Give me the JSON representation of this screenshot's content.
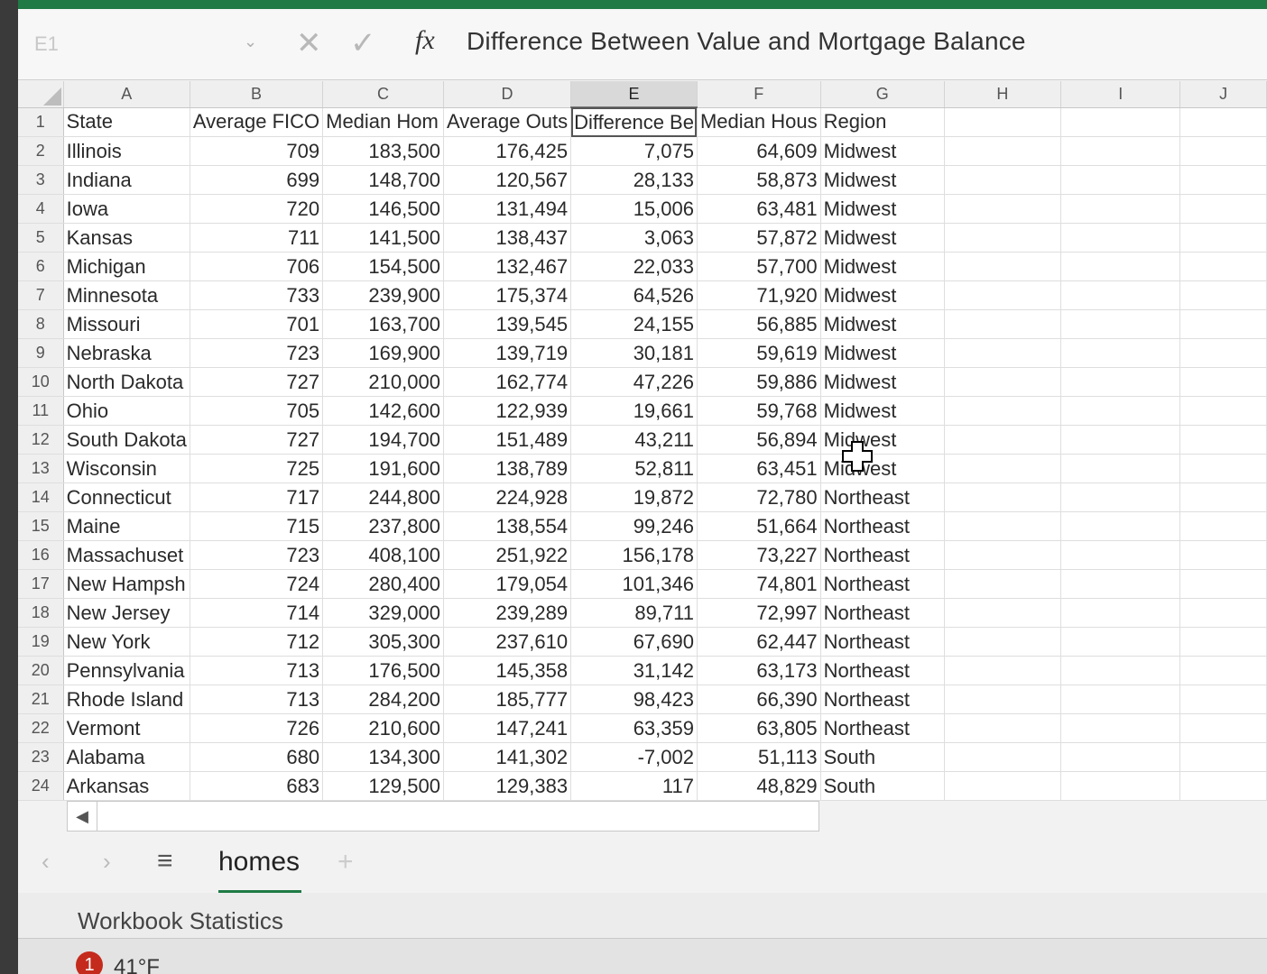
{
  "formula_bar": {
    "name_box": "E1",
    "fx_label": "fx",
    "cancel_glyph": "✕",
    "enter_glyph": "✓",
    "content": "Difference Between Value and Mortgage Balance"
  },
  "columns": [
    "A",
    "B",
    "C",
    "D",
    "E",
    "F",
    "G",
    "H",
    "I",
    "J"
  ],
  "selected_column": "E",
  "rows": [
    {
      "n": "1",
      "cells": [
        "State",
        "Average FICO",
        "Median Hom",
        "Average Outs",
        "Difference Be",
        "Median Hous",
        "Region"
      ]
    },
    {
      "n": "2",
      "cells": [
        "Illinois",
        "709",
        "183,500",
        "176,425",
        "7,075",
        "64,609",
        "Midwest"
      ]
    },
    {
      "n": "3",
      "cells": [
        "Indiana",
        "699",
        "148,700",
        "120,567",
        "28,133",
        "58,873",
        "Midwest"
      ]
    },
    {
      "n": "4",
      "cells": [
        "Iowa",
        "720",
        "146,500",
        "131,494",
        "15,006",
        "63,481",
        "Midwest"
      ]
    },
    {
      "n": "5",
      "cells": [
        "Kansas",
        "711",
        "141,500",
        "138,437",
        "3,063",
        "57,872",
        "Midwest"
      ]
    },
    {
      "n": "6",
      "cells": [
        "Michigan",
        "706",
        "154,500",
        "132,467",
        "22,033",
        "57,700",
        "Midwest"
      ]
    },
    {
      "n": "7",
      "cells": [
        "Minnesota",
        "733",
        "239,900",
        "175,374",
        "64,526",
        "71,920",
        "Midwest"
      ]
    },
    {
      "n": "8",
      "cells": [
        "Missouri",
        "701",
        "163,700",
        "139,545",
        "24,155",
        "56,885",
        "Midwest"
      ]
    },
    {
      "n": "9",
      "cells": [
        "Nebraska",
        "723",
        "169,900",
        "139,719",
        "30,181",
        "59,619",
        "Midwest"
      ]
    },
    {
      "n": "10",
      "cells": [
        "North Dakota",
        "727",
        "210,000",
        "162,774",
        "47,226",
        "59,886",
        "Midwest"
      ]
    },
    {
      "n": "11",
      "cells": [
        "Ohio",
        "705",
        "142,600",
        "122,939",
        "19,661",
        "59,768",
        "Midwest"
      ]
    },
    {
      "n": "12",
      "cells": [
        "South Dakota",
        "727",
        "194,700",
        "151,489",
        "43,211",
        "56,894",
        "Midwest"
      ]
    },
    {
      "n": "13",
      "cells": [
        "Wisconsin",
        "725",
        "191,600",
        "138,789",
        "52,811",
        "63,451",
        "Midwest"
      ]
    },
    {
      "n": "14",
      "cells": [
        "Connecticut",
        "717",
        "244,800",
        "224,928",
        "19,872",
        "72,780",
        "Northeast"
      ]
    },
    {
      "n": "15",
      "cells": [
        "Maine",
        "715",
        "237,800",
        "138,554",
        "99,246",
        "51,664",
        "Northeast"
      ]
    },
    {
      "n": "16",
      "cells": [
        "Massachuset",
        "723",
        "408,100",
        "251,922",
        "156,178",
        "73,227",
        "Northeast"
      ]
    },
    {
      "n": "17",
      "cells": [
        "New Hampsh",
        "724",
        "280,400",
        "179,054",
        "101,346",
        "74,801",
        "Northeast"
      ]
    },
    {
      "n": "18",
      "cells": [
        "New Jersey",
        "714",
        "329,000",
        "239,289",
        "89,711",
        "72,997",
        "Northeast"
      ]
    },
    {
      "n": "19",
      "cells": [
        "New York",
        "712",
        "305,300",
        "237,610",
        "67,690",
        "62,447",
        "Northeast"
      ]
    },
    {
      "n": "20",
      "cells": [
        "Pennsylvania",
        "713",
        "176,500",
        "145,358",
        "31,142",
        "63,173",
        "Northeast"
      ]
    },
    {
      "n": "21",
      "cells": [
        "Rhode Island",
        "713",
        "284,200",
        "185,777",
        "98,423",
        "66,390",
        "Northeast"
      ]
    },
    {
      "n": "22",
      "cells": [
        "Vermont",
        "726",
        "210,600",
        "147,241",
        "63,359",
        "63,805",
        "Northeast"
      ]
    },
    {
      "n": "23",
      "cells": [
        "Alabama",
        "680",
        "134,300",
        "141,302",
        "-7,002",
        "51,113",
        "South"
      ]
    },
    {
      "n": "24",
      "cells": [
        "Arkansas",
        "683",
        "129,500",
        "129,383",
        "117",
        "48,829",
        "South"
      ]
    }
  ],
  "sheet_tabs": {
    "prev_glyph": "‹",
    "next_glyph": "›",
    "menu_glyph": "≡",
    "active_tab": "homes",
    "add_glyph": "+"
  },
  "status_bar": {
    "text": "Workbook Statistics"
  },
  "taskbar": {
    "badge": "1",
    "weather": "41°F"
  },
  "scroll": {
    "left_glyph": "◀"
  },
  "colors": {
    "accent": "#1f7a45",
    "badge": "#c42b1c"
  }
}
